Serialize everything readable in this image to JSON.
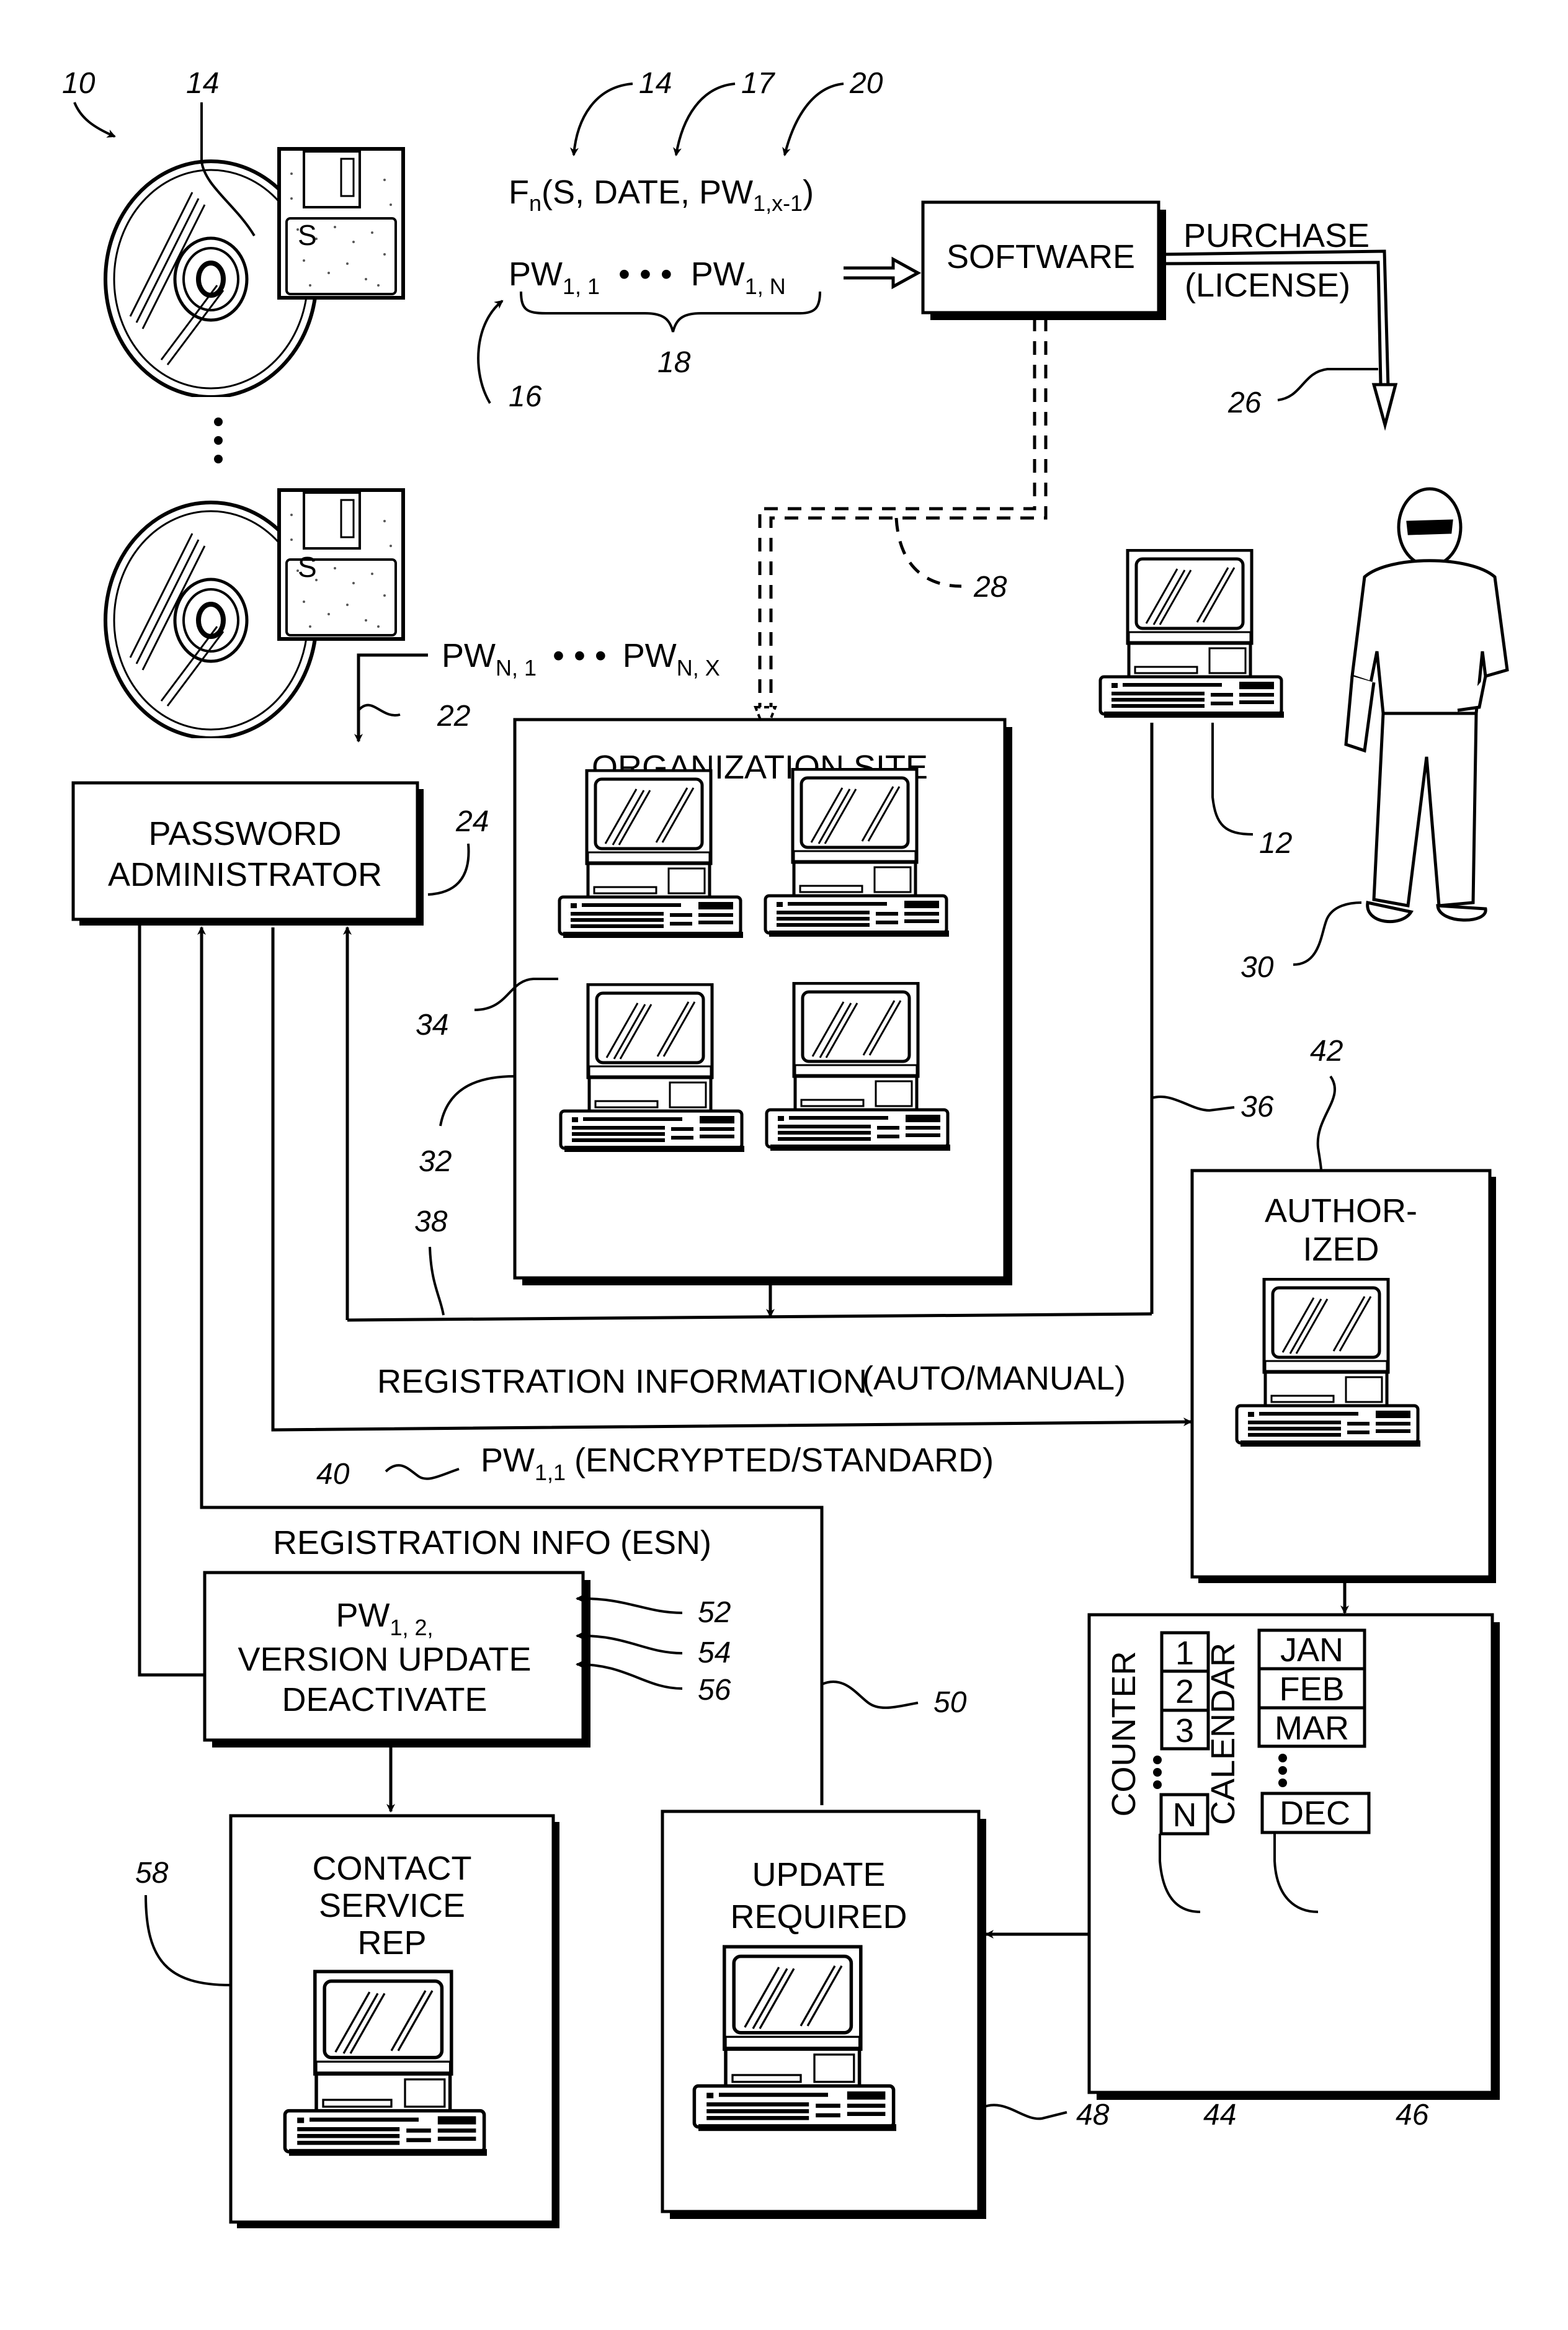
{
  "figure": {
    "media": {
      "disk_letter": "S",
      "ellipsis": "⋮"
    },
    "formula": {
      "fn": "F",
      "fn_sub": "n",
      "args": "(S, DATE, PW",
      "args_sub": "1,x-1",
      "close": ")"
    },
    "pw_series_top": {
      "first": "PW",
      "first_sub": "1, 1",
      "dots": "• • •",
      "last": "PW",
      "last_sub": "1, N"
    },
    "pw_series_mid": {
      "first": "PW",
      "first_sub": "N, 1",
      "dots": "• • •",
      "last": "PW",
      "last_sub": "N, X"
    },
    "boxes": {
      "software": "SOFTWARE",
      "password_admin_line1": "PASSWORD",
      "password_admin_line2": "ADMINISTRATOR",
      "organization_site": "ORGANIZATION SITE",
      "authorized_line1": "AUTHOR-",
      "authorized_line2": "IZED",
      "actions_line1": "PW",
      "actions_line1_sub": "1, 2,",
      "actions_line2": "VERSION UPDATE",
      "actions_line3": "DEACTIVATE",
      "contact_line1": "CONTACT",
      "contact_line2": "SERVICE",
      "contact_line3": "REP",
      "update_line1": "UPDATE",
      "update_line2": "REQUIRED"
    },
    "flow_labels": {
      "purchase": "PURCHASE",
      "license": "(LICENSE)",
      "registration_information": "REGISTRATION INFORMATION",
      "auto_manual": "(AUTO/MANUAL)",
      "pw11": "PW",
      "pw11_sub": "1,1",
      "encrypted_standard": "(ENCRYPTED/STANDARD)",
      "registration_info_esn": "REGISTRATION INFO (ESN)"
    },
    "counter": {
      "title": "COUNTER",
      "cells": [
        "1",
        "2",
        "3"
      ],
      "last": "N"
    },
    "calendar": {
      "title": "CALENDAR",
      "cells": [
        "JAN",
        "FEB",
        "MAR"
      ],
      "last": "DEC"
    },
    "reference_numerals": {
      "r10": "10",
      "r14a": "14",
      "r14b": "14",
      "r17": "17",
      "r20": "20",
      "r16": "16",
      "r18": "18",
      "r26": "26",
      "r28": "28",
      "r22": "22",
      "r24": "24",
      "r12": "12",
      "r30": "30",
      "r34": "34",
      "r32": "32",
      "r36": "36",
      "r38": "38",
      "r42": "42",
      "r40": "40",
      "r52": "52",
      "r54": "54",
      "r56": "56",
      "r50": "50",
      "r58": "58",
      "r48": "48",
      "r44": "44",
      "r46": "46"
    }
  }
}
